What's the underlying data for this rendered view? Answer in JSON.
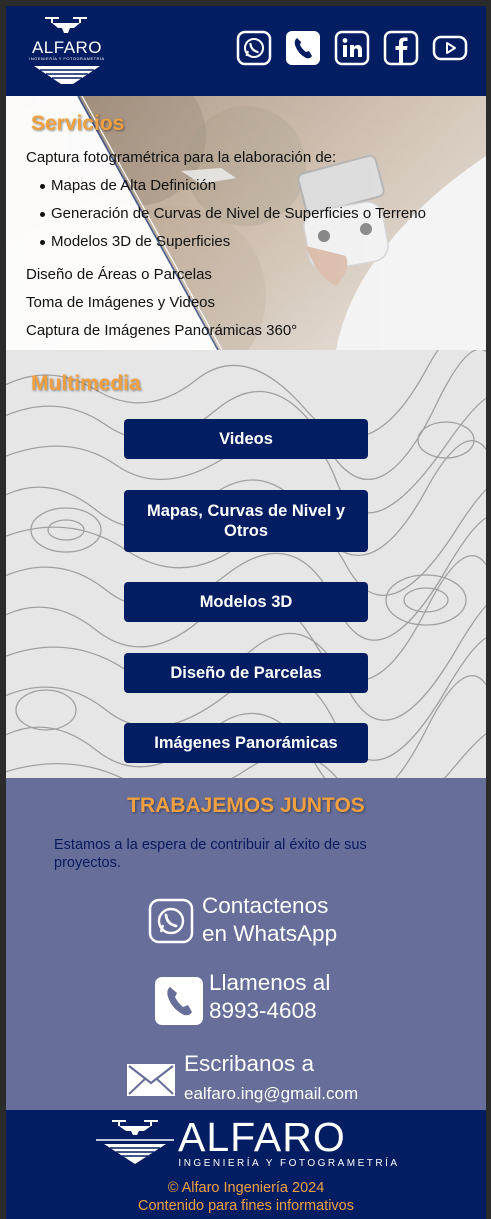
{
  "header": {
    "logo_text": "ALFARO",
    "logo_sub": "INGENIERÍA Y FOTOGRAMETRÍA",
    "social_icons": [
      "whatsapp-icon",
      "phone-icon",
      "linkedin-icon",
      "facebook-icon",
      "youtube-icon"
    ]
  },
  "servicios": {
    "title": "Servicios",
    "intro": "Captura fotogramétrica para la elaboración de:",
    "bullets": [
      "Mapas de Alta Definición",
      "Generación de Curvas de Nivel de Superficies o Terreno",
      "Modelos 3D de Superficies"
    ],
    "items": [
      "Diseño de Áreas o Parcelas",
      "Toma de Imágenes y Videos",
      "Captura de Imágenes Panorámicas 360°"
    ]
  },
  "multimedia": {
    "title": "Multimedia",
    "buttons": [
      "Videos",
      "Mapas, Curvas de Nivel y Otros",
      "Modelos 3D",
      "Diseño de Parcelas",
      "Imágenes Panorámicas"
    ]
  },
  "trabajemos": {
    "title": "TRABAJEMOS JUNTOS",
    "description": "Estamos a la espera de contribuir al éxito de sus proyectos.",
    "whatsapp_line1": "Contactenos",
    "whatsapp_line2": "en WhatsApp",
    "phone_line1": "Llamenos al",
    "phone_line2": "8993-4608",
    "email_line1": "Escribanos a",
    "email_line2": "ealfaro.ing@gmail.com"
  },
  "footer": {
    "brand": "ALFARO",
    "sub": "INGENIERÍA Y FOTOGRAMETRÍA",
    "copyright": "© Alfaro Ingeniería 2024",
    "note": "Contenido para fines informativos"
  },
  "colors": {
    "navy": "#031d62",
    "accent_orange": "#f0a040",
    "section_bg": "#666e99"
  }
}
